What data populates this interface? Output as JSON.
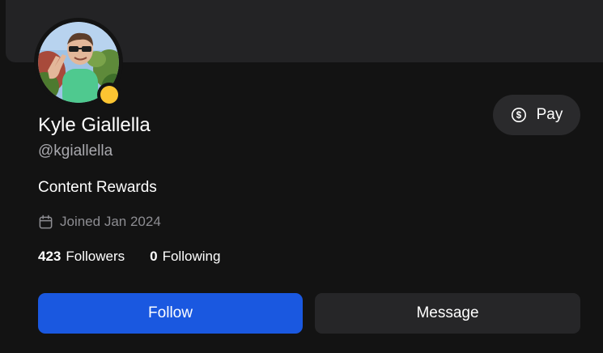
{
  "profile": {
    "name": "Kyle Giallella",
    "handle": "@kgiallella",
    "bio": "Content Rewards",
    "joined": "Joined Jan 2024",
    "status_color": "#fcc532"
  },
  "stats": {
    "followers_count": "423",
    "followers_label": "Followers",
    "following_count": "0",
    "following_label": "Following"
  },
  "actions": {
    "pay_label": "Pay",
    "follow_label": "Follow",
    "message_label": "Message"
  },
  "icons": {
    "pay": "dollar-circle-icon",
    "joined": "calendar-icon"
  },
  "colors": {
    "background": "#131313",
    "banner": "#232325",
    "accent": "#1a58e0",
    "secondary_button": "#262628",
    "muted_text": "#8d8d92"
  }
}
